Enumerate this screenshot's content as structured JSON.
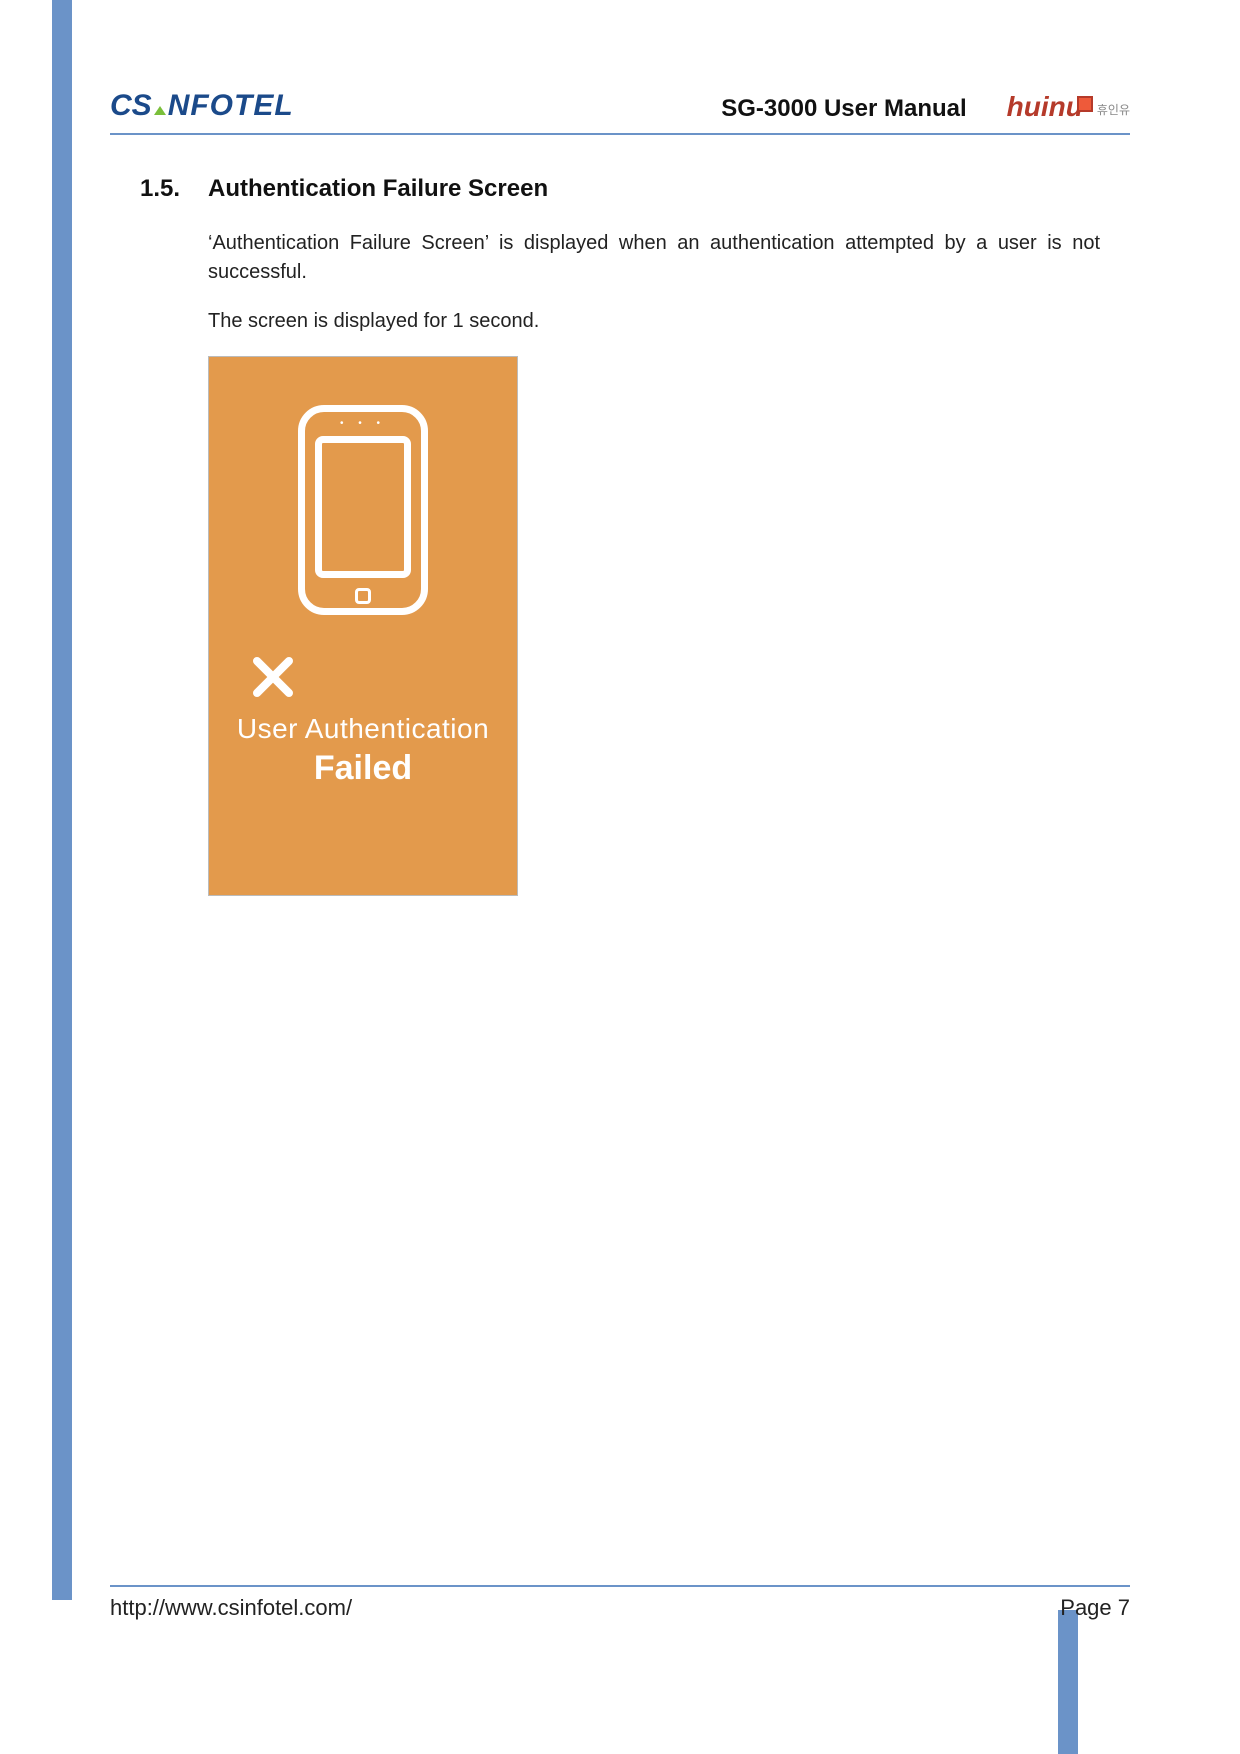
{
  "header": {
    "logo_left_cs": "CS",
    "logo_left_rest": "NFOTEL",
    "doc_title": "SG-3000 User Manual",
    "logo_right_main": "huin",
    "logo_right_u": "u",
    "logo_right_kor": "휴인유"
  },
  "section": {
    "number": "1.5.",
    "title": "Authentication Failure Screen",
    "para1": "‘Authentication Failure Screen’ is displayed when an authentication attempted by a user is not successful.",
    "para2": "The screen is displayed for 1 second."
  },
  "figure": {
    "line1": "User Authentication",
    "line2": "Failed"
  },
  "footer": {
    "url": "http://www.csinfotel.com/",
    "page": "Page 7"
  }
}
